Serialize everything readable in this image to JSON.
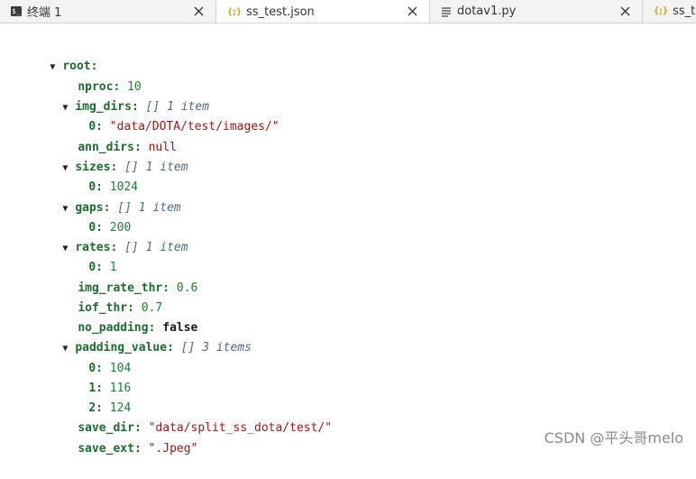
{
  "tabs": [
    {
      "label": "终端 1",
      "icon": "terminal-icon",
      "active": false
    },
    {
      "label": "ss_test.json",
      "icon": "json-icon",
      "active": true
    },
    {
      "label": "dotav1.py",
      "icon": "text-file-icon",
      "active": false
    },
    {
      "label": "ss_tra",
      "icon": "json-icon",
      "active": false
    }
  ],
  "icons": {
    "close": "close-icon",
    "twisty": "▼",
    "json_glyph": "{;}",
    "terminal_glyph": "$_"
  },
  "colors": {
    "key": "#1b6c2e",
    "number": "#1a7f34",
    "string": "#a31515",
    "meta": "#4e6a7d"
  },
  "tree": {
    "root": {
      "key": "root",
      "colon": ":"
    },
    "nproc": {
      "key": "nproc",
      "colon": ":",
      "value": "10"
    },
    "img_dirs": {
      "key": "img_dirs",
      "colon": ":",
      "type": "[]",
      "count": "1 item"
    },
    "img_dirs_0": {
      "key": "0",
      "colon": ":",
      "value": "\"data/DOTA/test/images/\""
    },
    "ann_dirs": {
      "key": "ann_dirs",
      "colon": ":",
      "value": "null"
    },
    "sizes": {
      "key": "sizes",
      "colon": ":",
      "type": "[]",
      "count": "1 item"
    },
    "sizes_0": {
      "key": "0",
      "colon": ":",
      "value": "1024"
    },
    "gaps": {
      "key": "gaps",
      "colon": ":",
      "type": "[]",
      "count": "1 item"
    },
    "gaps_0": {
      "key": "0",
      "colon": ":",
      "value": "200"
    },
    "rates": {
      "key": "rates",
      "colon": ":",
      "type": "[]",
      "count": "1 item"
    },
    "rates_0": {
      "key": "0",
      "colon": ":",
      "value": "1"
    },
    "img_rate_thr": {
      "key": "img_rate_thr",
      "colon": ":",
      "value": "0.6"
    },
    "iof_thr": {
      "key": "iof_thr",
      "colon": ":",
      "value": "0.7"
    },
    "no_padding": {
      "key": "no_padding",
      "colon": ":",
      "value": "false"
    },
    "padding_value": {
      "key": "padding_value",
      "colon": ":",
      "type": "[]",
      "count": "3 items"
    },
    "padding_value_0": {
      "key": "0",
      "colon": ":",
      "value": "104"
    },
    "padding_value_1": {
      "key": "1",
      "colon": ":",
      "value": "116"
    },
    "padding_value_2": {
      "key": "2",
      "colon": ":",
      "value": "124"
    },
    "save_dir": {
      "key": "save_dir",
      "colon": ":",
      "value": "\"data/split_ss_dota/test/\""
    },
    "save_ext": {
      "key": "save_ext",
      "colon": ":",
      "value": "\".Jpeg\""
    }
  },
  "watermark": "CSDN @平头哥melo"
}
